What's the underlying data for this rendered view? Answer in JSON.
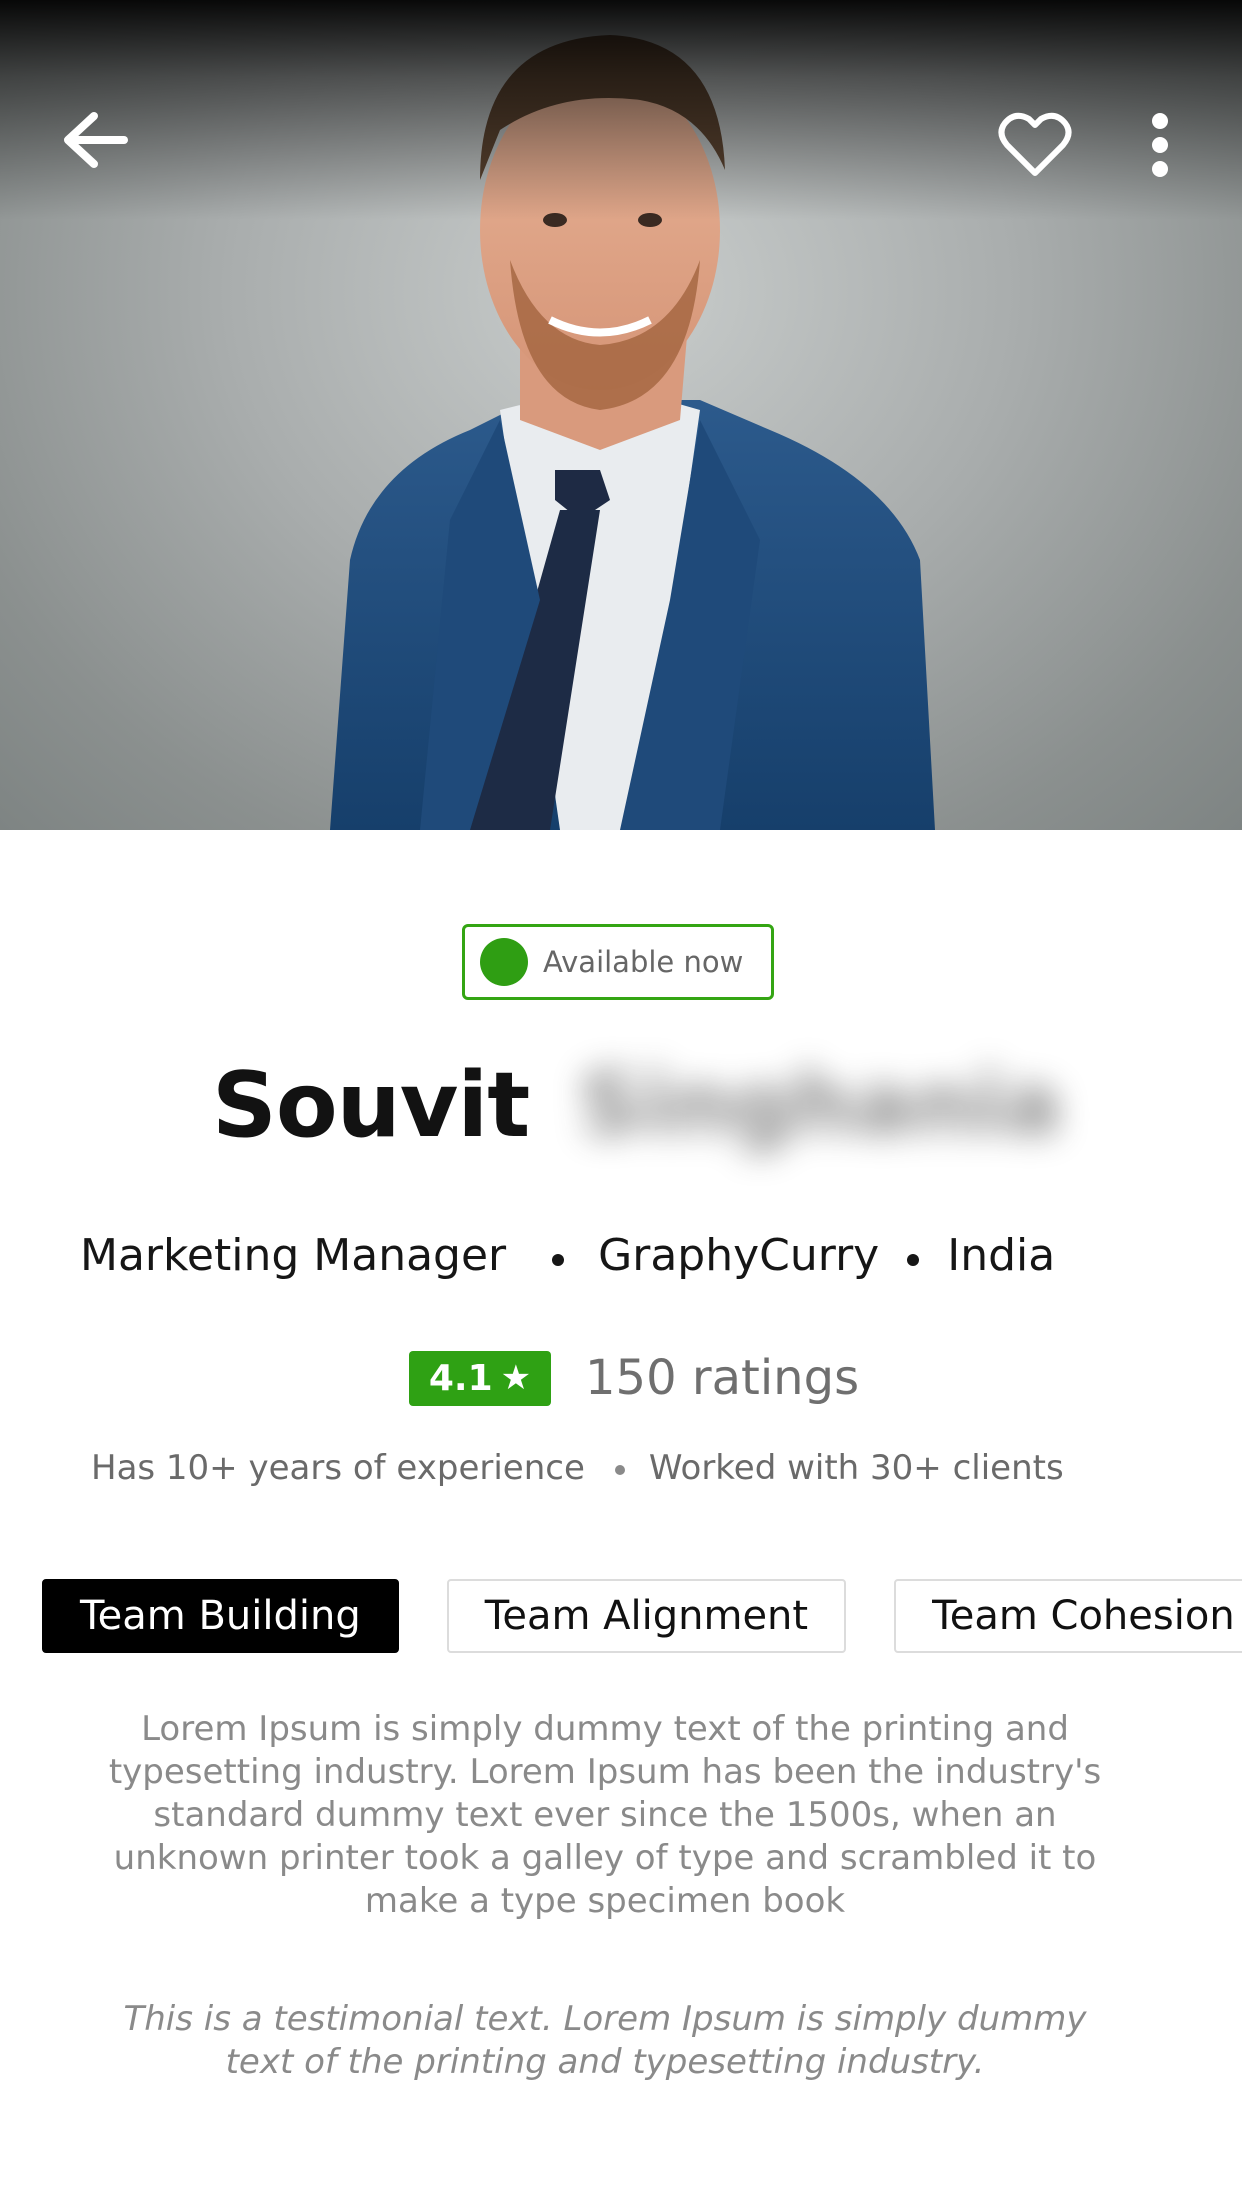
{
  "profile": {
    "availability": "Available now",
    "first_name": "Souvit",
    "last_name": "Singhania",
    "role": "Marketing Manager",
    "company": "GraphyCurry",
    "country": "India",
    "rating": "4.1",
    "ratings_count": "150 ratings",
    "experience": "Has 10+ years of experience",
    "clients": "Worked with 30+ clients"
  },
  "tags": [
    {
      "label": "Team Building",
      "active": true
    },
    {
      "label": "Team Alignment",
      "active": false
    },
    {
      "label": "Team Cohesion",
      "active": false
    }
  ],
  "description": "Lorem Ipsum is simply dummy text of the printing and typesetting industry. Lorem Ipsum has been the industry's standard dummy text ever since the 1500s, when an unknown printer took a galley of type and scrambled it to make a type specimen book",
  "testimonial": "This is a testimonial text. Lorem Ipsum is simply dummy text of the printing and typesetting industry.",
  "icons": {
    "back": "arrow-left-icon",
    "favorite": "heart-outline-icon",
    "more": "more-vertical-icon",
    "star": "star-icon"
  },
  "colors": {
    "accent_green": "#2fa114",
    "active_tag": "#000000"
  }
}
